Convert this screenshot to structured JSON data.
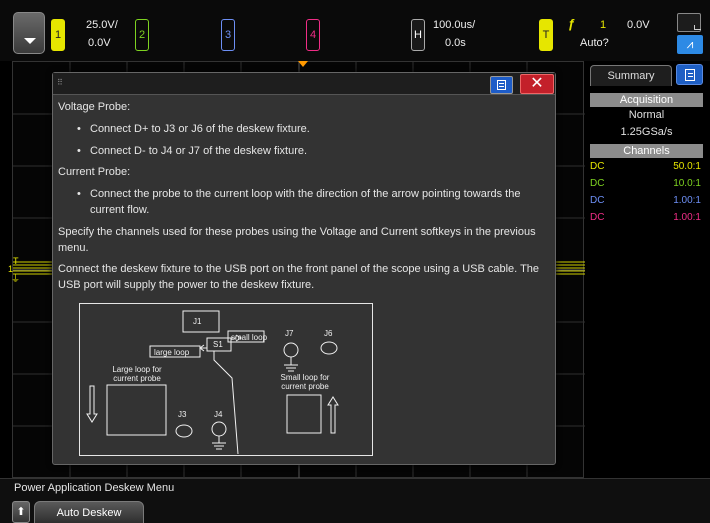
{
  "topbar": {
    "ch1": {
      "number": "1",
      "scale": "25.0V/",
      "offset": "0.0V"
    },
    "ch2": {
      "number": "2"
    },
    "ch3": {
      "number": "3"
    },
    "ch4": {
      "number": "4"
    },
    "horizontal": {
      "label": "H",
      "timebase": "100.0us/",
      "delay": "0.0s"
    },
    "trigger": {
      "label": "T",
      "source": "1",
      "level": "0.0V",
      "mode": "Auto?"
    }
  },
  "waveform": {
    "trigger_marker": "T",
    "channel_marker": "1"
  },
  "sidebar": {
    "tab_label": "Summary",
    "acquisition": {
      "heading": "Acquisition",
      "mode": "Normal",
      "rate": "1.25GSa/s"
    },
    "channels": {
      "heading": "Channels",
      "rows": [
        {
          "coupling": "DC",
          "ratio": "50.0:1",
          "color": "#e6e600"
        },
        {
          "coupling": "DC",
          "ratio": "10.0:1",
          "color": "#7ed321"
        },
        {
          "coupling": "DC",
          "ratio": "1.00:1",
          "color": "#6d8ff5"
        },
        {
          "coupling": "DC",
          "ratio": "1.00:1",
          "color": "#f02d86"
        }
      ]
    }
  },
  "dialog": {
    "close_symbol": "✕",
    "voltage_heading": "Voltage Probe:",
    "voltage_bullet1": "Connect D+ to J3 or J6 of the deskew fixture.",
    "voltage_bullet2": "Connect D- to J4 or J7 of the deskew fixture.",
    "current_heading": "Current Probe:",
    "current_bullet1": "Connect the probe to the current loop with the direction of the arrow pointing towards the current flow.",
    "specify_text": "Specify the channels used for these probes using the Voltage and Current softkeys in the previous menu.",
    "connect_text": "Connect the deskew fixture to the USB port on the front panel of the scope using a USB cable. The USB port will supply the power to the deskew fixture.",
    "diagram": {
      "j1": "J1",
      "s1": "S1",
      "small_loop_tag": "small loop",
      "large_loop_tag": "large loop",
      "j7": "J7",
      "j6": "J6",
      "j3": "J3",
      "j4": "J4",
      "large_loop_label": "Large loop for current probe",
      "small_loop_label": "Small loop for current probe"
    }
  },
  "menu": {
    "title": "Power Application Deskew Menu",
    "back_symbol": "⬆",
    "softkey1": "Auto Deskew"
  }
}
